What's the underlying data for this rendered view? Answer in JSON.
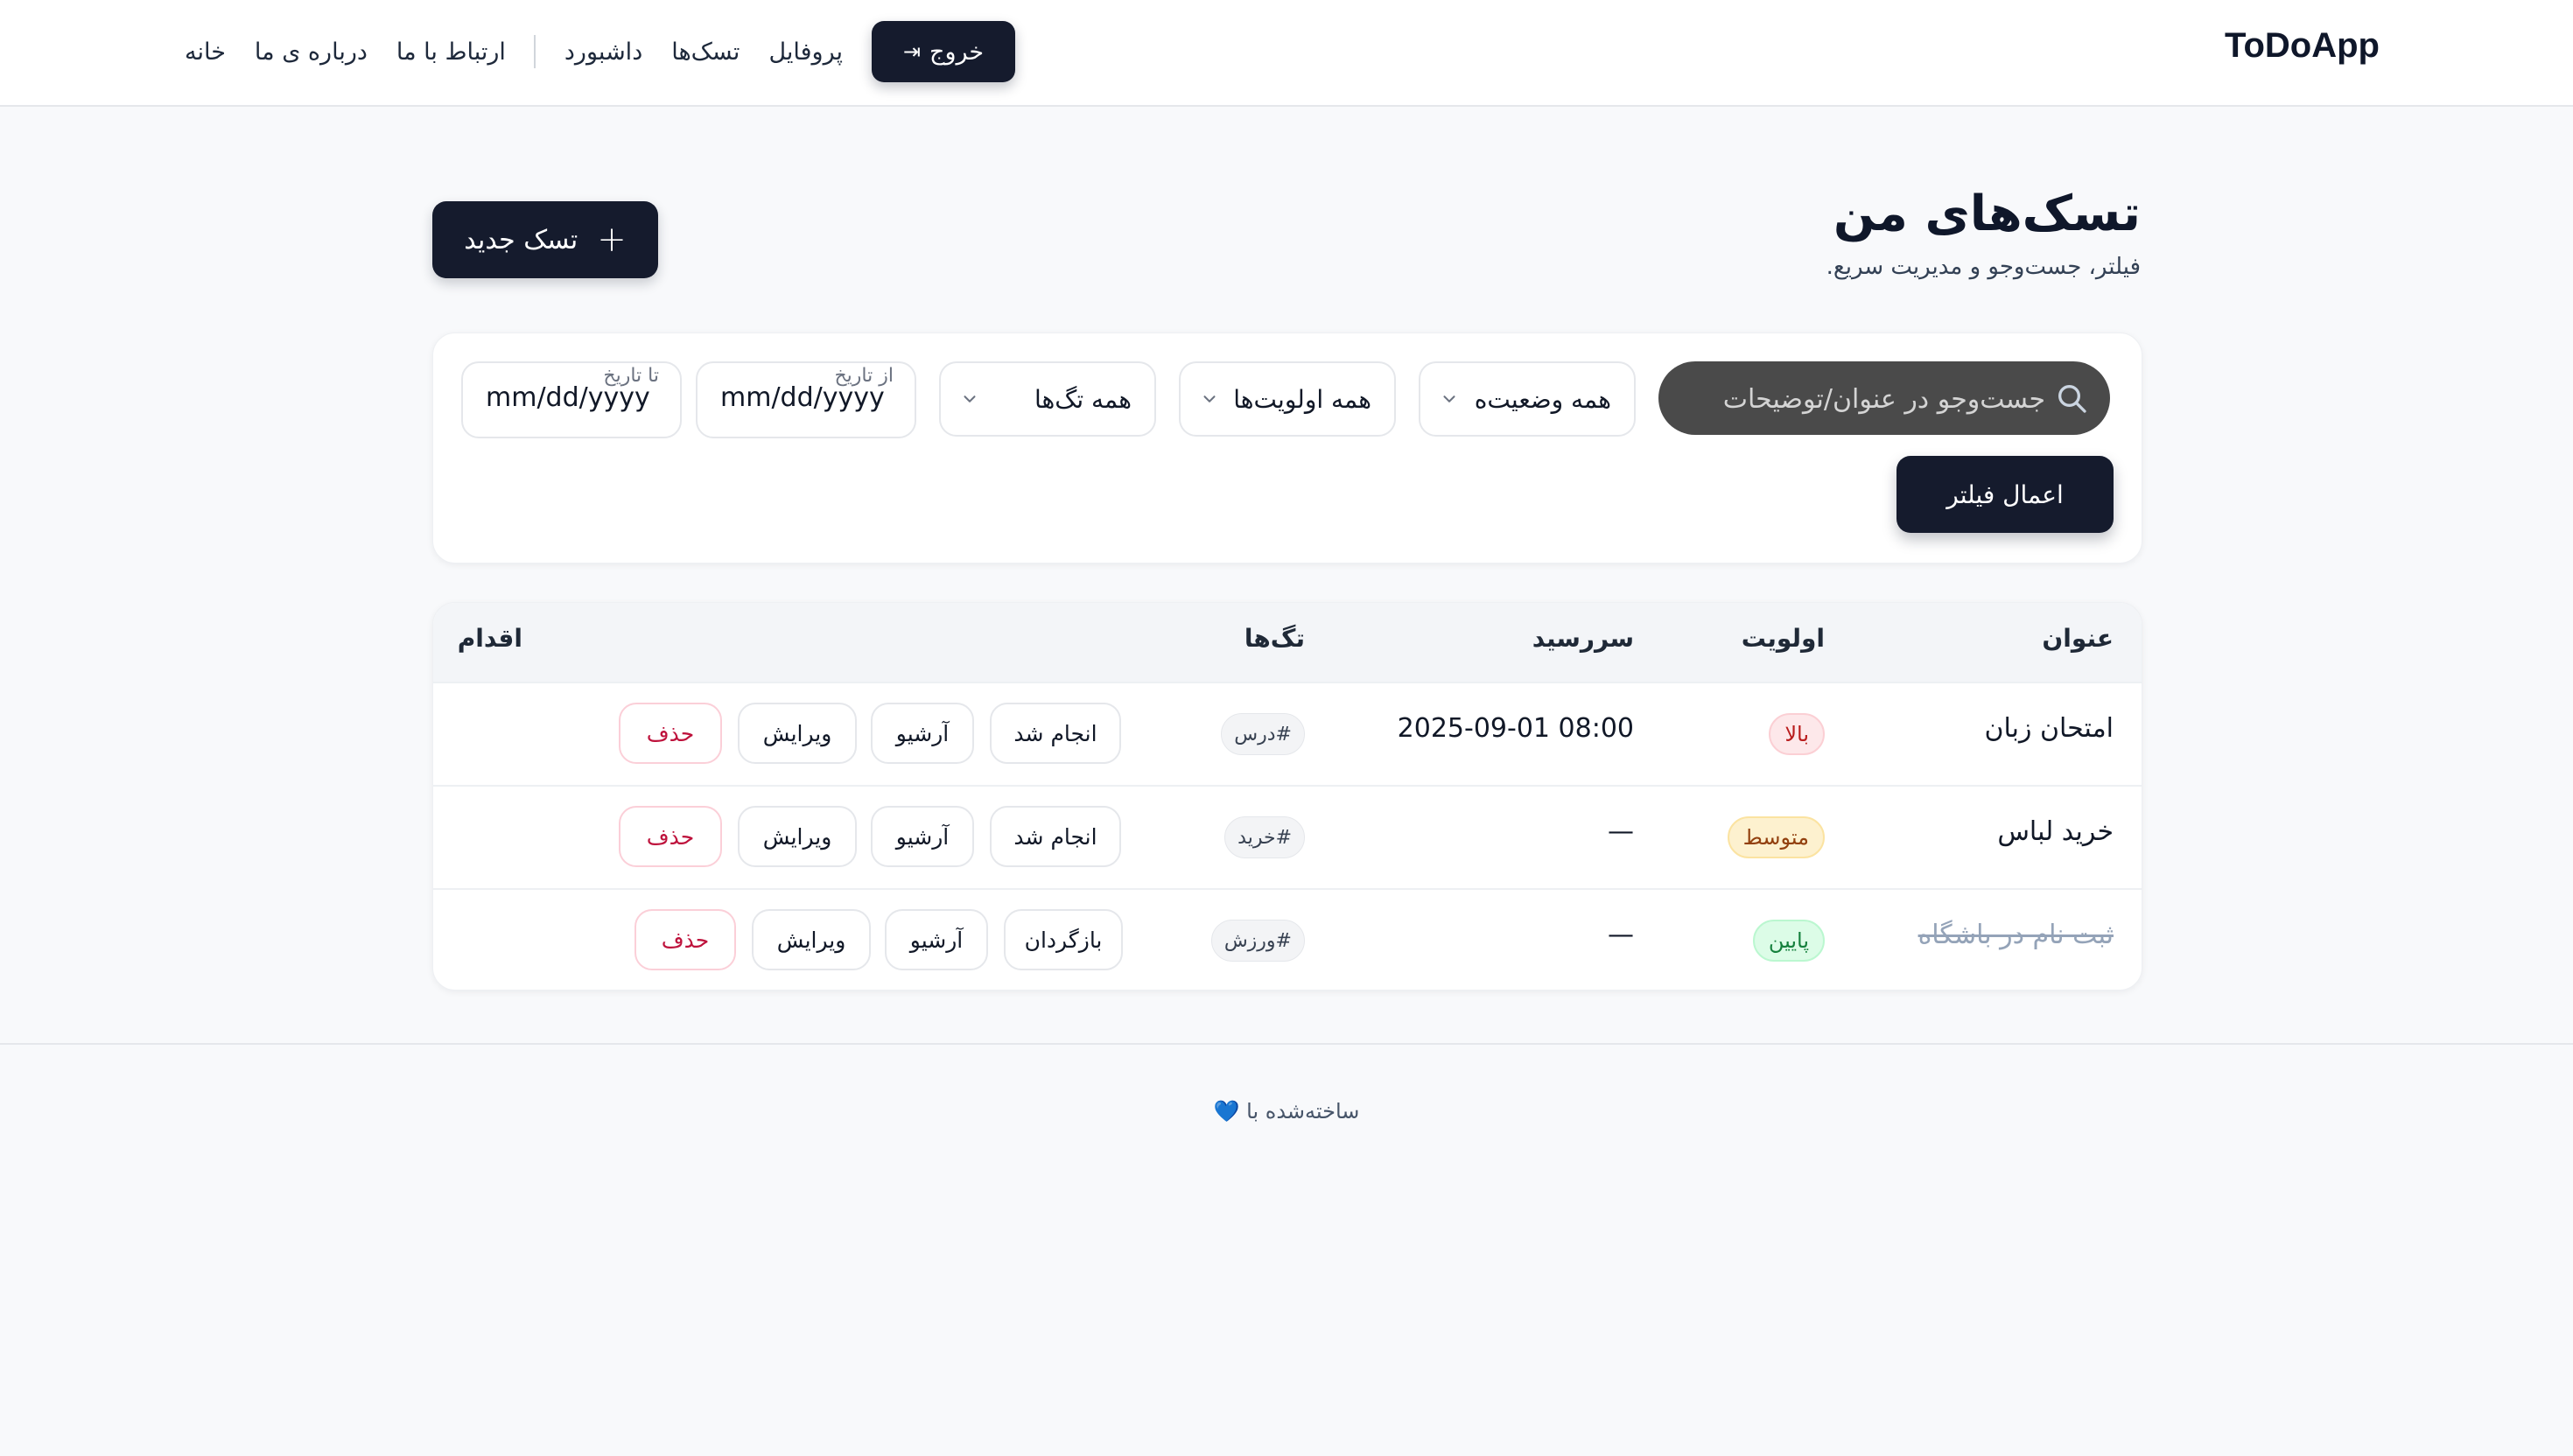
{
  "header": {
    "brand": "ToDoApp",
    "nav": {
      "home": "خانه",
      "about": "درباره ی ما",
      "contact": "ارتباط با ما",
      "dashboard": "داشبورد",
      "tasks": "تسک‌ها",
      "profile": "پروفایل",
      "logout": "خروج",
      "logout_icon": "⇥"
    }
  },
  "page": {
    "title": "تسک‌های من",
    "subtitle": "فیلتر، جست‌وجو و مدیریت سریع.",
    "new_task_label": "تسک جدید",
    "new_task_icon": "+"
  },
  "filters": {
    "search_placeholder": "جست‌وجو در عنوان/توضیحات",
    "status_label": "همه وضعیت‌ه",
    "priority_label": "همه اولویت‌ها",
    "tags_label": "همه تگ‌ها",
    "from_date_caption": "از تاریخ",
    "from_date_value": "mm/dd/yyyy",
    "to_date_caption": "تا تاریخ",
    "to_date_value": "mm/dd/yyyy",
    "apply_label": "اعمال فیلتر"
  },
  "table": {
    "headers": {
      "title": "عنوان",
      "priority": "اولویت",
      "due": "سررسید",
      "tags": "تگ‌ها",
      "actions": "اقدام"
    },
    "rows": [
      {
        "title": "امتحان زبان",
        "priority": "بالا",
        "due": "2025-09-01 08:00",
        "tag": "#درس",
        "actions": [
          "انجام شد",
          "آرشیو",
          "ویرایش",
          "حذف"
        ]
      },
      {
        "title": "خرید لباس",
        "priority": "متوسط",
        "due": "—",
        "tag": "#خرید",
        "actions": [
          "انجام شد",
          "آرشیو",
          "ویرایش",
          "حذف"
        ]
      },
      {
        "title": "ثبت نام در باشگاه",
        "priority": "پایین",
        "due": "—",
        "tag": "#ورزش",
        "actions": [
          "بازگردان",
          "آرشیو",
          "ویرایش",
          "حذف"
        ]
      }
    ]
  },
  "footer": {
    "text": "ساخته‌شده با",
    "heart": "💙"
  },
  "colors": {
    "primary_dark": "#151b2d",
    "background": "#f8f9fb",
    "danger": "#be123c",
    "high": "#b91c1c",
    "medium": "#92400e",
    "low": "#15803d"
  }
}
